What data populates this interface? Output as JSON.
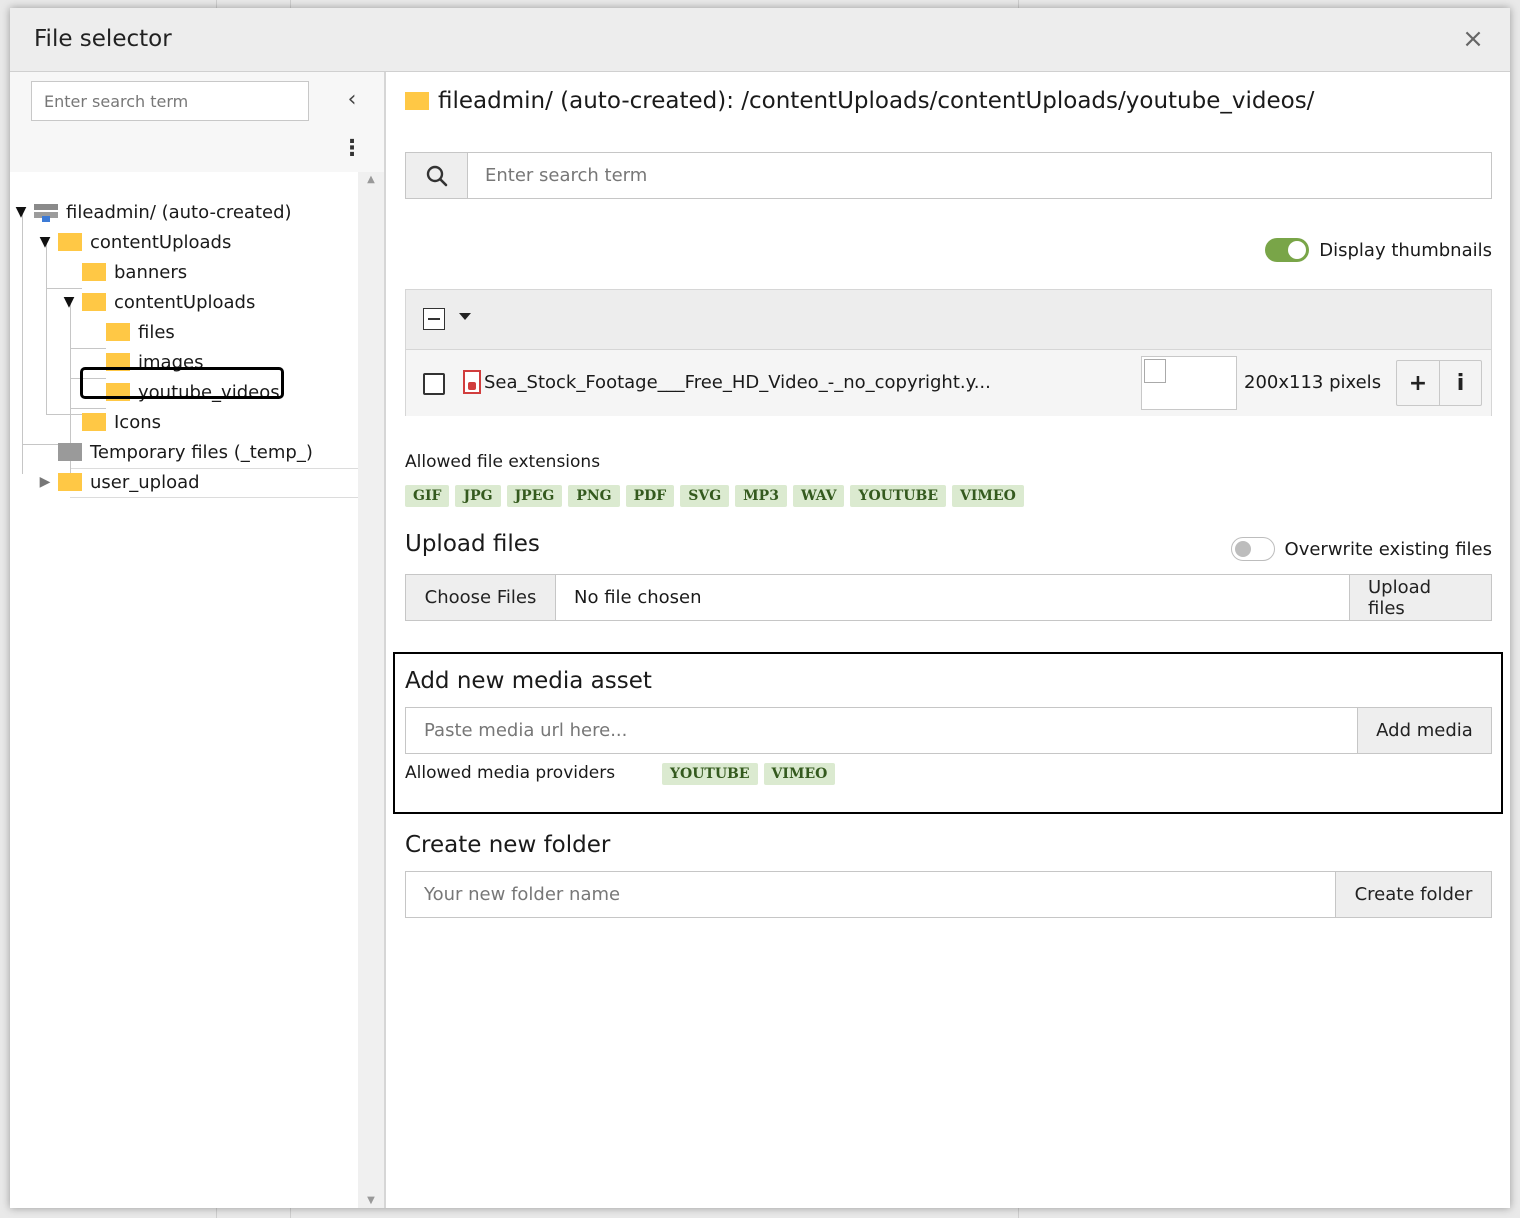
{
  "dialog": {
    "title": "File selector",
    "close_symbol": "×"
  },
  "tree": {
    "search_placeholder": "Enter search term",
    "collapse_symbol": "‹",
    "menu_symbol": "⋮",
    "nodes": {
      "root": {
        "label": "fileadmin/ (auto-created)"
      },
      "content_uploads": {
        "label": "contentUploads"
      },
      "banners": {
        "label": "banners"
      },
      "content_uploads_inner": {
        "label": "contentUploads"
      },
      "files": {
        "label": "files"
      },
      "images": {
        "label": "images"
      },
      "youtube_videos": {
        "label": "youtube_videos"
      },
      "icons": {
        "label": "Icons"
      },
      "temp": {
        "label": "Temporary files (_temp_)"
      },
      "user_upload": {
        "label": "user_upload"
      }
    }
  },
  "main": {
    "path": "fileadmin/ (auto-created): /contentUploads/contentUploads/youtube_videos/",
    "search_placeholder": "Enter search term",
    "display_thumbnails_label": "Display thumbnails",
    "file_row": {
      "name": "Sea_Stock_Footage___Free_HD_Video_-_no_copyright.y...",
      "dimensions": "200x113 pixels",
      "add_symbol": "+",
      "info_symbol": "i"
    },
    "allowed_ext_label": "Allowed file extensions",
    "extensions": [
      "GIF",
      "JPG",
      "JPEG",
      "PNG",
      "PDF",
      "SVG",
      "MP3",
      "WAV",
      "YOUTUBE",
      "VIMEO"
    ],
    "upload": {
      "title": "Upload files",
      "overwrite_label": "Overwrite existing files",
      "choose_label": "Choose Files",
      "no_file_label": "No file chosen",
      "upload_label": "Upload files"
    },
    "media": {
      "title": "Add new media asset",
      "placeholder": "Paste media url here...",
      "button": "Add media",
      "providers_label": "Allowed media providers",
      "providers": [
        "YOUTUBE",
        "VIMEO"
      ]
    },
    "folder": {
      "title": "Create new folder",
      "placeholder": "Your new folder name",
      "button": "Create folder"
    }
  },
  "colors": {
    "accent_toggle": "#79a548",
    "folder": "#ffc845",
    "badge_bg": "#dbead0"
  }
}
